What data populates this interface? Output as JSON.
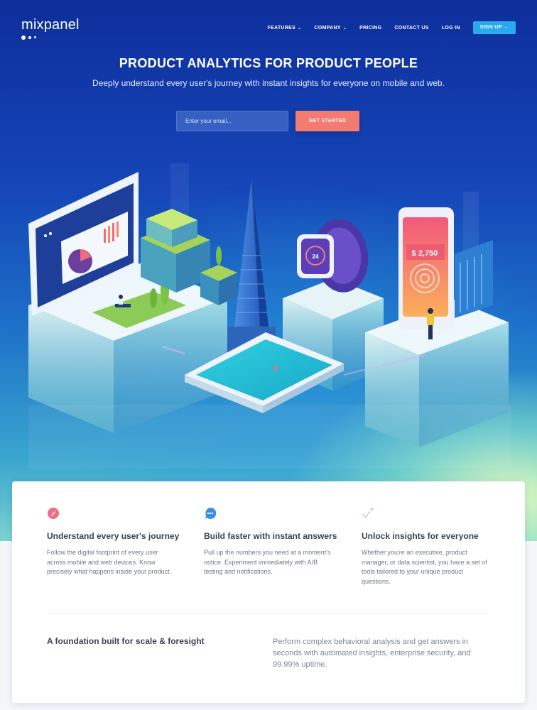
{
  "nav": {
    "logo": "mixpanel",
    "items": [
      {
        "label": "FEATURES",
        "has_dropdown": true
      },
      {
        "label": "COMPANY",
        "has_dropdown": true
      },
      {
        "label": "PRICING",
        "has_dropdown": false
      },
      {
        "label": "CONTACT US",
        "has_dropdown": false
      },
      {
        "label": "LOG IN",
        "has_dropdown": false
      }
    ],
    "signup_label": "SIGN UP →"
  },
  "hero": {
    "title": "PRODUCT ANALYTICS FOR PRODUCT PEOPLE",
    "subtitle": "Deeply understand every user's journey with instant insights for everyone on mobile and web.",
    "email_placeholder": "Enter your email...",
    "cta_label": "GET STARTED"
  },
  "illustration": {
    "watch_value": "24",
    "phone_value": "$ 2,750"
  },
  "features": [
    {
      "icon": "pen-icon",
      "title": "Understand every user's journey",
      "description": "Follow the digital footprint of every user across mobile and web devices. Know precisely what happens inside your product."
    },
    {
      "icon": "chat-icon",
      "title": "Build faster with instant answers",
      "description": "Pull up the numbers you need at a moment's notice. Experiment immediately with A/B testing and notifications."
    },
    {
      "icon": "checkmark-icon",
      "title": "Unlock insights for everyone",
      "description": "Whether you're an executive, product manager, or data scientist, you have a set of tools tailored to your unique product questions."
    }
  ],
  "foundation": {
    "title": "A foundation built for scale & foresight",
    "description": "Perform complex behavioral analysis and get answers in seconds with automated insights, enterprise security, and 99.99% uptime."
  },
  "colors": {
    "accent": "#f47b6f",
    "signup": "#2ba9ef",
    "hero_top": "#0e2e9c"
  }
}
